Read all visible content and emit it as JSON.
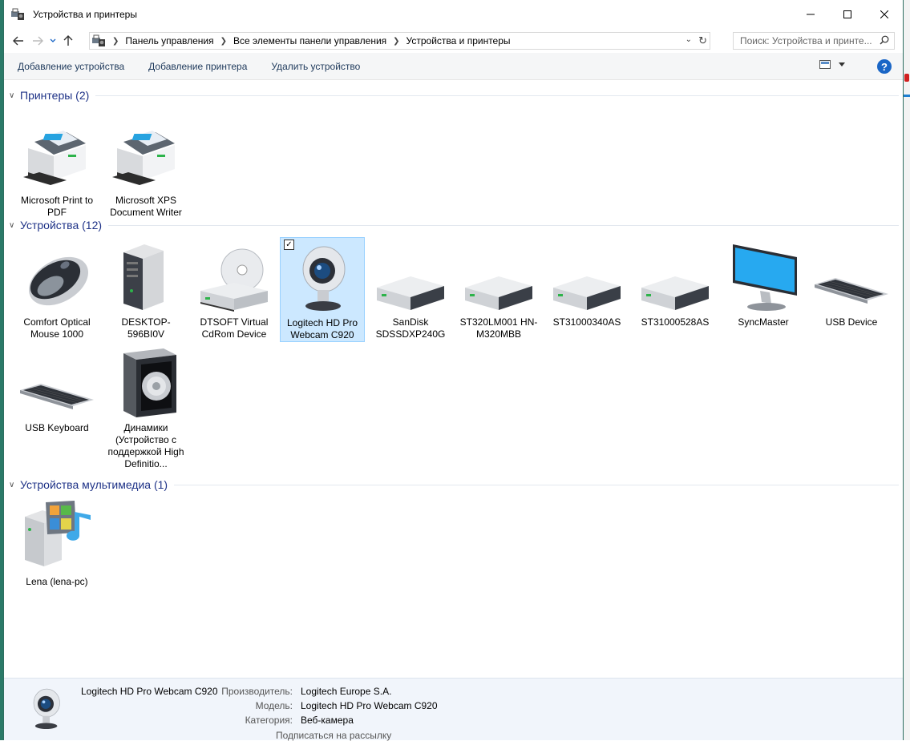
{
  "window": {
    "title": "Устройства и принтеры"
  },
  "address": {
    "crumbs": [
      "Панель управления",
      "Все элементы панели управления",
      "Устройства и принтеры"
    ],
    "search_placeholder": "Поиск: Устройства и принте..."
  },
  "commands": {
    "add_device": "Добавление устройства",
    "add_printer": "Добавление принтера",
    "remove_device": "Удалить устройство"
  },
  "groups": {
    "printers": {
      "title": "Принтеры (2)",
      "items": [
        {
          "label": "Microsoft Print to PDF",
          "icon": "printer-icon"
        },
        {
          "label": "Microsoft XPS Document Writer",
          "icon": "printer-icon"
        }
      ]
    },
    "devices": {
      "title": "Устройства (12)",
      "items": [
        {
          "label": "Comfort Optical Mouse 1000",
          "icon": "mouse-icon"
        },
        {
          "label": "DESKTOP-596BI0V",
          "icon": "computer-tower-icon"
        },
        {
          "label": "DTSOFT Virtual CdRom Device",
          "icon": "cdrom-drive-icon"
        },
        {
          "label": "Logitech HD Pro Webcam C920",
          "icon": "webcam-icon"
        },
        {
          "label": "SanDisk SDSSDXP240G",
          "icon": "hard-drive-icon"
        },
        {
          "label": "ST320LM001 HN-M320MBB",
          "icon": "hard-drive-icon"
        },
        {
          "label": "ST31000340AS",
          "icon": "hard-drive-icon"
        },
        {
          "label": "ST31000528AS",
          "icon": "hard-drive-icon"
        },
        {
          "label": "SyncMaster",
          "icon": "monitor-icon"
        },
        {
          "label": "USB Device",
          "icon": "keyboard-icon"
        },
        {
          "label": "USB Keyboard",
          "icon": "keyboard-icon"
        },
        {
          "label": "Динамики (Устройство с поддержкой High Definitio...",
          "icon": "speaker-icon"
        }
      ]
    },
    "multimedia": {
      "title": "Устройства мультимедиа (1)",
      "items": [
        {
          "label": "Lena (lena-pc)",
          "icon": "media-server-icon"
        }
      ]
    }
  },
  "details": {
    "name": "Logitech HD Pro Webcam C920",
    "manufacturer_key": "Производитель:",
    "manufacturer_value": "Logitech Europe S.A.",
    "model_key": "Модель:",
    "model_value": "Logitech HD Pro Webcam C920",
    "category_key": "Категория:",
    "category_value": "Веб-камера"
  },
  "background_text": "Подписаться на рассылку",
  "colors": {
    "link": "#1e395b",
    "group_title": "#1e3287",
    "selection": "#cce8ff",
    "accent": "#1a66c6"
  }
}
